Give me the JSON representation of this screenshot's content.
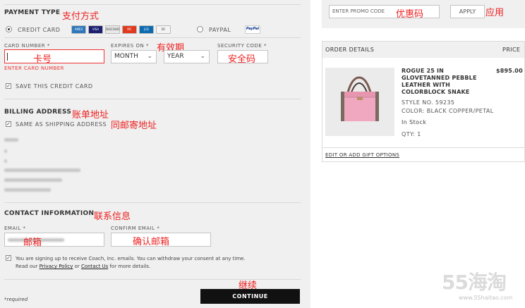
{
  "payment": {
    "title": "PAYMENT TYPE",
    "title_cn": "支付方式",
    "credit_card_label": "CREDIT CARD",
    "paypal_label": "PAYPAL",
    "card_logos": [
      {
        "name": "amex-card-icon",
        "text": "AMEX",
        "color": "#2e77bb"
      },
      {
        "name": "visa-card-icon",
        "text": "VISA",
        "color": "#1a1f71"
      },
      {
        "name": "discover-card-icon",
        "text": "DISCOVER",
        "color": "#e8e8e8"
      },
      {
        "name": "mastercard-card-icon",
        "text": "MC",
        "color": "#e03a1e"
      },
      {
        "name": "jcb-card-icon",
        "text": "JCB",
        "color": "#0b6ab0"
      },
      {
        "name": "diners-card-icon",
        "text": "DC",
        "color": "#f4f4f4"
      }
    ],
    "paypal_logo": "PayPal",
    "card_number_label": "CARD NUMBER",
    "card_number_cn": "卡号",
    "card_number_error": "ENTER CARD NUMBER",
    "expires_label": "EXPIRES ON",
    "expires_cn": "有效期",
    "month_value": "MONTH",
    "year_value": "YEAR",
    "security_label": "SECURITY CODE",
    "security_cn": "安全码",
    "save_card_label": "SAVE THIS CREDIT CARD",
    "required_star": "*"
  },
  "billing": {
    "title": "BILLING ADDRESS",
    "title_cn": "账单地址",
    "same_label": "SAME AS SHIPPING ADDRESS",
    "same_cn": "同邮寄地址"
  },
  "contact": {
    "title": "CONTACT INFORMATION",
    "title_cn": "联系信息",
    "email_label": "EMAIL",
    "email_cn": "邮箱",
    "confirm_label": "CONFIRM EMAIL",
    "confirm_cn": "确认邮箱",
    "consent_line1": "You are signing up to receive Coach, Inc. emails. You can withdraw your consent at any time.",
    "consent_line2_a": "Read our ",
    "privacy_link": "Privacy Policy",
    "consent_or": " or ",
    "contact_link": "Contact Us",
    "consent_line2_b": " for more details."
  },
  "footer": {
    "required_note": "*required",
    "continue_cn": "继续",
    "continue_label": "CONTINUE"
  },
  "promo": {
    "placeholder": "ENTER PROMO CODE",
    "placeholder_cn": "优惠码",
    "apply_label": "APPLY",
    "apply_cn": "应用"
  },
  "order": {
    "header": "ORDER DETAILS",
    "price_header": "PRICE",
    "product_name_lines": [
      "ROGUE 25 IN",
      "GLOVETANNED PEBBLE",
      "LEATHER WITH",
      "COLORBLOCK SNAKE"
    ],
    "price": "$895.00",
    "style_no": "STYLE NO. 59235",
    "color": "COLOR: BLACK COPPER/PETAL",
    "stock": "In Stock",
    "qty": "QTY: 1",
    "gift_link": "EDIT OR ADD GIFT OPTIONS"
  },
  "watermark": {
    "text": "55海淘",
    "url": "www.55haitao.com"
  },
  "colors": {
    "accent_red": "#ee2222",
    "button_black": "#111111",
    "bag_pink": "#f0a8c0"
  }
}
